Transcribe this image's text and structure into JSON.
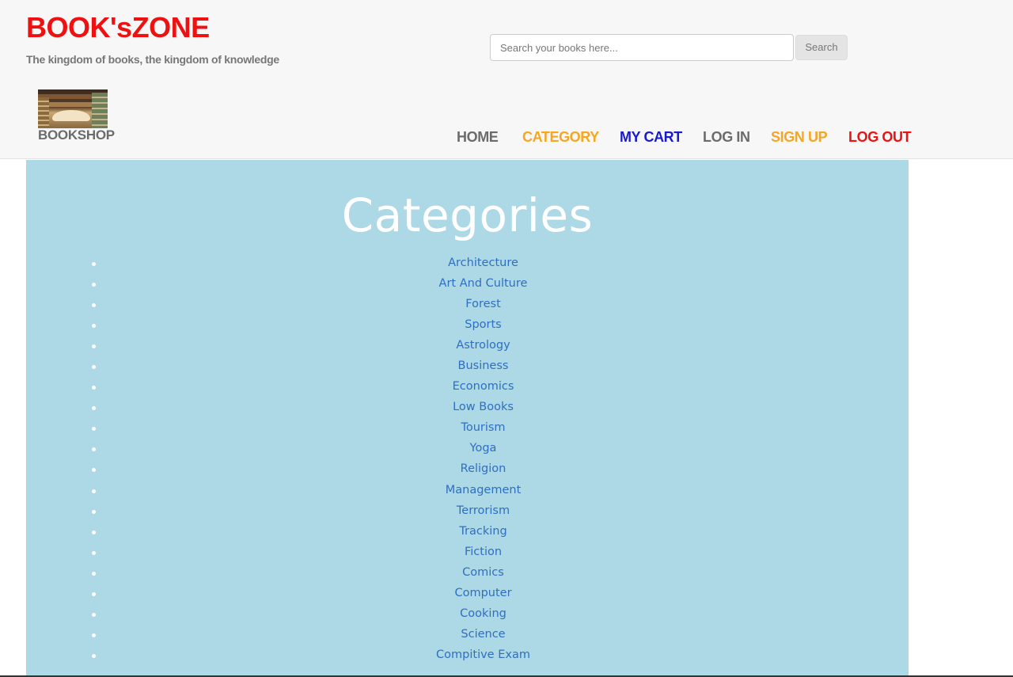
{
  "brand": {
    "title": "BOOK'sZONE",
    "tagline": "The kingdom of books, the kingdom of knowledge",
    "logo_label": "BOOKSHOP"
  },
  "search": {
    "placeholder": "Search your books here...",
    "button_label": "Search"
  },
  "nav": [
    {
      "label": "HOME",
      "color": "#6b6b6b"
    },
    {
      "label": "CATEGORY",
      "color": "#f5a623"
    },
    {
      "label": "MY CART",
      "color": "#1a1acc"
    },
    {
      "label": "LOG IN",
      "color": "#6b6b6b"
    },
    {
      "label": "SIGN UP",
      "color": "#f5a623"
    },
    {
      "label": "LOG OUT",
      "color": "#ee1111"
    }
  ],
  "main": {
    "heading": "Categories",
    "background_color": "#add8e6",
    "categories": [
      "Architecture",
      "Art And Culture",
      "Forest",
      "Sports",
      "Astrology",
      "Business",
      "Economics",
      "Low Books",
      "Tourism",
      "Yoga",
      "Religion",
      "Management",
      "Terrorism",
      "Tracking",
      "Fiction",
      "Comics",
      "Computer",
      "Cooking",
      "Science",
      "Compitive Exam"
    ]
  }
}
